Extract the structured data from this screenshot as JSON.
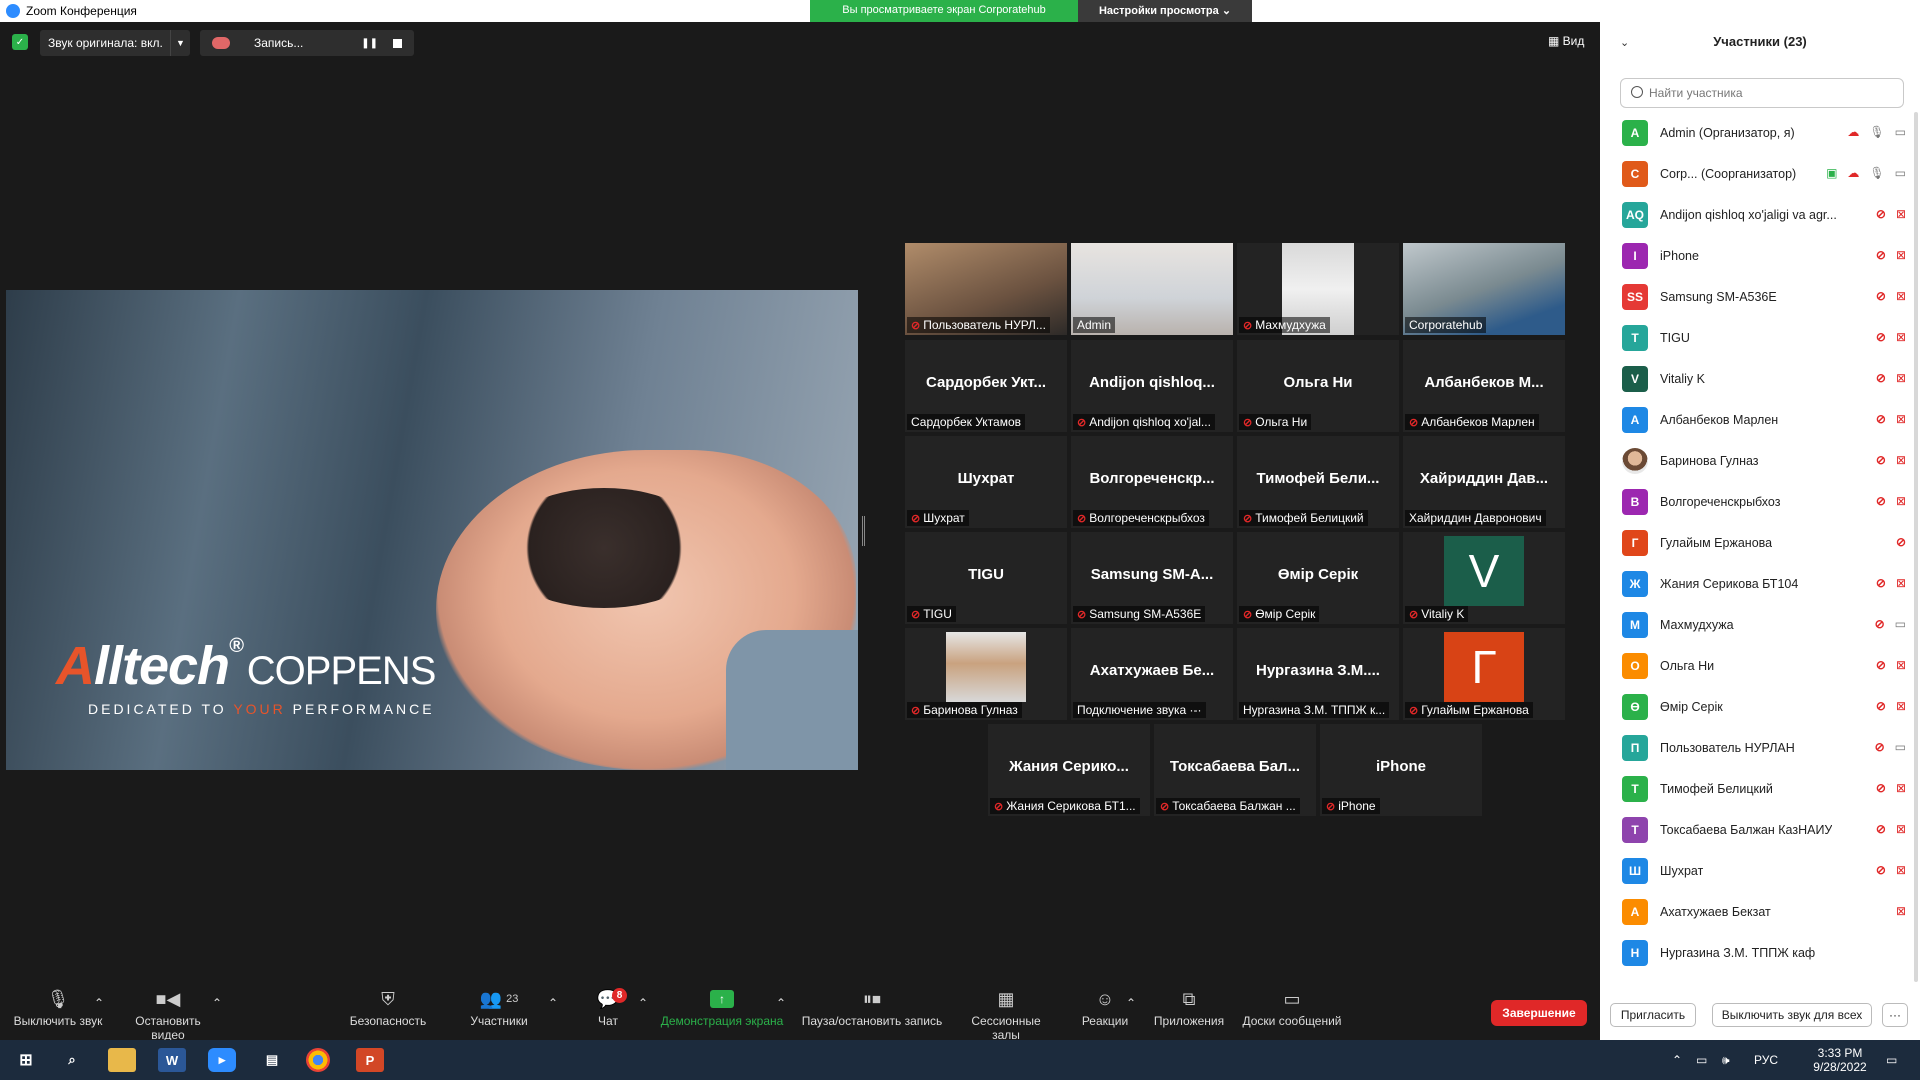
{
  "window": {
    "title": "Zoom Конференция"
  },
  "share_banner": {
    "viewing": "Вы просматриваете экран Corporatehub",
    "settings": "Настройки просмотра"
  },
  "top": {
    "audio": "Звук оригинала: вкл.",
    "record": "Запись...",
    "view": "Вид"
  },
  "slide": {
    "brand_a": "A",
    "brand_rest": "lltech",
    "reg": "®",
    "coppens": "COPPENS",
    "tag1": "DEDICATED TO ",
    "tag_your": "YOUR",
    "tag2": " PERFORMANCE"
  },
  "tiles": [
    {
      "big": "",
      "name": "Пользователь НУРЛ...",
      "muted": true
    },
    {
      "big": "",
      "name": "Admin",
      "muted": false
    },
    {
      "big": "",
      "name": "Махмудхужа",
      "muted": true
    },
    {
      "big": "",
      "name": "Corporatehub",
      "muted": false
    },
    {
      "big": "Сардорбек Укт...",
      "name": "Сардорбек Уктамов",
      "muted": false
    },
    {
      "big": "Andijon qishloq...",
      "name": "Andijon qishloq xo'jal...",
      "muted": true
    },
    {
      "big": "Ольга Ни",
      "name": "Ольга Ни",
      "muted": true
    },
    {
      "big": "Албанбеков М...",
      "name": "Албанбеков Марлен",
      "muted": true
    },
    {
      "big": "Шухрат",
      "name": "Шухрат",
      "muted": true
    },
    {
      "big": "Волгореченскр...",
      "name": "Волгореченскрыбхоз",
      "muted": true
    },
    {
      "big": "Тимофей Бели...",
      "name": "Тимофей Белицкий",
      "muted": true
    },
    {
      "big": "Хайриддин Дав...",
      "name": "Хайриддин Давронович",
      "muted": false
    },
    {
      "big": "TIGU",
      "name": "TIGU",
      "muted": true
    },
    {
      "big": "Samsung SM-A...",
      "name": "Samsung SM-A536E",
      "muted": true
    },
    {
      "big": "Өмір Серік",
      "name": "Өмір Серік",
      "muted": true
    },
    {
      "big": "V",
      "name": "Vitaliy K",
      "muted": true
    },
    {
      "big": "",
      "name": "Баринова Гулназ",
      "muted": true
    },
    {
      "big": "Ахатхужаев Бе...",
      "name": "Подключение звука ·-·",
      "muted": false
    },
    {
      "big": "Нургазина З.М....",
      "name": "Нургазина З.М. ТППЖ к...",
      "muted": false
    },
    {
      "big": "Г",
      "name": "Гулайым Ержанова",
      "muted": true
    },
    {
      "big": "Жания Серико...",
      "name": "Жания Серикова БТ1...",
      "muted": true
    },
    {
      "big": "Токсабаева Бал...",
      "name": "Токсабаева Балжан ...",
      "muted": true
    },
    {
      "big": "iPhone",
      "name": "iPhone",
      "muted": true
    }
  ],
  "toolbar": {
    "mute": "Выключить звук",
    "video": "Остановить видео",
    "security": "Безопасность",
    "participants": "Участники",
    "participants_count": "23",
    "chat": "Чат",
    "chat_badge": "8",
    "share": "Демонстрация экрана",
    "record": "Пауза/остановить запись",
    "breakout": "Сессионные залы",
    "reactions": "Реакции",
    "apps": "Приложения",
    "whiteboard": "Доски сообщений",
    "end": "Завершение"
  },
  "panel": {
    "title": "Участники (23)",
    "search_placeholder": "Найти участника",
    "participants": [
      {
        "initials": "A",
        "color": "#2bb14a",
        "name": "Admin (Организатор, я)"
      },
      {
        "initials": "C",
        "color": "#e05a1a",
        "name": "Corp... (Соорганизатор)"
      },
      {
        "initials": "AQ",
        "color": "#26a69a",
        "name": "Andijon qishloq xo'jaligi va agr..."
      },
      {
        "initials": "I",
        "color": "#9c27b0",
        "name": "iPhone"
      },
      {
        "initials": "SS",
        "color": "#e53935",
        "name": "Samsung SM-A536E"
      },
      {
        "initials": "T",
        "color": "#26a69a",
        "name": "TIGU"
      },
      {
        "initials": "V",
        "color": "#1b5e4a",
        "name": "Vitaliy K"
      },
      {
        "initials": "A",
        "color": "#1e88e5",
        "name": "Албанбеков Марлен"
      },
      {
        "initials": "",
        "color": "#c9a07a",
        "name": "Баринова Гулназ"
      },
      {
        "initials": "B",
        "color": "#9c27b0",
        "name": "Волгореченскрыбхоз"
      },
      {
        "initials": "Г",
        "color": "#e0461a",
        "name": "Гулайым Ержанова"
      },
      {
        "initials": "Ж",
        "color": "#1e88e5",
        "name": "Жания Серикова БТ104"
      },
      {
        "initials": "М",
        "color": "#1e88e5",
        "name": "Махмудхужа"
      },
      {
        "initials": "О",
        "color": "#fb8c00",
        "name": "Ольга Ни"
      },
      {
        "initials": "Ө",
        "color": "#2bb14a",
        "name": "Өмір Серік"
      },
      {
        "initials": "П",
        "color": "#26a69a",
        "name": "Пользователь НУРЛАН"
      },
      {
        "initials": "Т",
        "color": "#2bb14a",
        "name": "Тимофей Белицкий"
      },
      {
        "initials": "Т",
        "color": "#8e44ad",
        "name": "Токсабаева Балжан КазНАИУ"
      },
      {
        "initials": "Ш",
        "color": "#1e88e5",
        "name": "Шухрат"
      },
      {
        "initials": "А",
        "color": "#fb8c00",
        "name": "Ахатхужаев Бекзат"
      },
      {
        "initials": "Н",
        "color": "#1e88e5",
        "name": "Нургазина З.М. ТППЖ каф"
      }
    ],
    "invite": "Пригласить",
    "mute_all": "Выключить звук для всех",
    "more": "···"
  },
  "taskbar": {
    "lang": "РУС",
    "time": "3:33 PM",
    "date": "9/28/2022"
  }
}
